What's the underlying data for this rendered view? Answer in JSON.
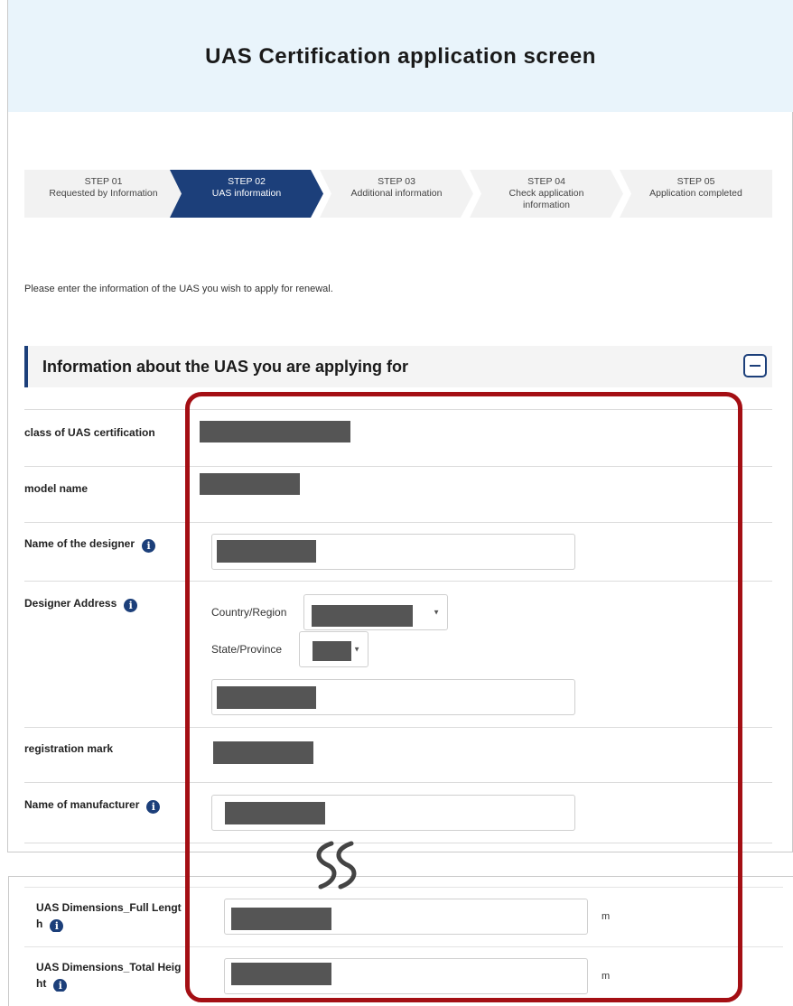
{
  "title": "UAS Certification application screen",
  "steps": [
    {
      "num": "STEP 01",
      "label": "Requested by Information",
      "active": false
    },
    {
      "num": "STEP 02",
      "label": "UAS information",
      "active": true
    },
    {
      "num": "STEP 03",
      "label": "Additional information",
      "active": false
    },
    {
      "num": "STEP 04",
      "label": "Check application information",
      "active": false
    },
    {
      "num": "STEP 05",
      "label": "Application completed",
      "active": false
    }
  ],
  "intro": "Please enter the information of the UAS you wish to apply for renewal.",
  "section": {
    "title": "Information about the UAS you are applying for",
    "collapse_icon": "minus-square-icon"
  },
  "fields": {
    "class_label": "class of UAS certification",
    "model_label": "model name",
    "designer_name_label": "Name of the designer",
    "designer_address_label": "Designer Address",
    "country_label": "Country/Region",
    "state_label": "State/Province",
    "registration_label": "registration mark",
    "manufacturer_label": "Name of manufacturer",
    "full_length_label": "UAS Dimensions_Full Length",
    "total_height_label": "UAS Dimensions_Total Height",
    "unit": "m"
  },
  "colors": {
    "header_bg": "#e9f4fb",
    "step_active": "#1c3f7a",
    "step_inactive": "#f2f2f2",
    "highlight": "#a40f14",
    "redaction": "#555555"
  }
}
